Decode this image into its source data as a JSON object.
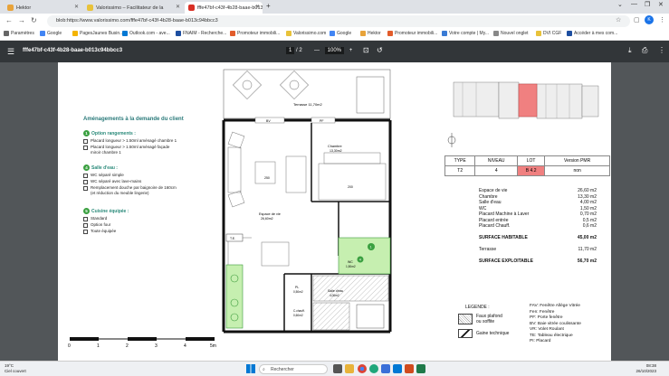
{
  "browser": {
    "tabs": [
      {
        "label": "Hektor",
        "color": "#e8a33a"
      },
      {
        "label": "Valorissimo – Facilitateur de la",
        "color": "#e8c23a"
      },
      {
        "label": "fffe47bf-c43f-4b28-baae-b013",
        "color": "#d93025"
      }
    ],
    "new_tab": "+",
    "url": "blob:https://www.valorissimo.com/fffe47bf-c43f-4b28-baae-b013c94bbcc3",
    "bookmarks": [
      "Paramètres",
      "Google",
      "PagesJaunes Busin...",
      "Outlook.com - ave...",
      "FNAIM - Recherche...",
      "Promoteur immobili...",
      "Valorissimo.com",
      "Google",
      "Hektor",
      "Promoteur immobili...",
      "Votre compte | My...",
      "Nouvel onglet",
      "DVI CGF",
      "Accéder à mes com..."
    ]
  },
  "pdf": {
    "title": "fffe47bf-c43f-4b28-baae-b013c94bbcc3",
    "page_current": "1",
    "page_total": "/ 2",
    "zoom": "100%"
  },
  "doc": {
    "heading": "Aménagements à la demande du client",
    "options": [
      {
        "num": "1",
        "title": "Option rangements :",
        "items": [
          "Placard longueur > 1.50ml aménagé chambre 1",
          "Placard longueur > 1.50ml aménagé façade",
          "miroir chambre 1"
        ]
      },
      {
        "num": "4",
        "title": "Salle d'eau :",
        "items": [
          "WC séparé simple",
          "WC séparé avec lave-mains",
          "Remplacement douche par baignoire de 160cm",
          "(et réduction du meuble lingerie)"
        ]
      },
      {
        "num": "5",
        "title": "Cuisine équipée :",
        "items": [
          "Standard",
          "Option four",
          "Toute équipée"
        ]
      }
    ],
    "plan_labels": {
      "terrasse": "Terrasse 11,70m2",
      "bv": "BV",
      "pf": "PF",
      "chambre": "Chambre",
      "chambre_area": "13,30m2",
      "sejour": "Espace de vie",
      "sejour_area": "26,60m2",
      "te": "T.E.",
      "wc": "WC",
      "wc_area": "1,50m2",
      "pl": "PL",
      "pl_area": "0,50m2",
      "salle_eau": "Salle d'eau",
      "salle_eau_area": "4,00m2",
      "chauf": "C.chauff.",
      "chauf_area": "0,60m2",
      "d250": "250",
      "d200": "200",
      "g1": "1",
      "g4": "4"
    },
    "scale": [
      "0",
      "1",
      "2",
      "3",
      "4",
      "5m"
    ],
    "table": {
      "headers": [
        "TYPE",
        "NIVEAU",
        "LOT",
        "Version PMR"
      ],
      "values": [
        "T2",
        "4",
        "B 4.2",
        "non"
      ],
      "lot_color": "#f08080"
    },
    "surfaces": [
      {
        "label": "Espace de vie",
        "value": "26,60 m2",
        "bold": false
      },
      {
        "label": "Chambre",
        "value": "13,30 m2",
        "bold": false
      },
      {
        "label": "Salle d'eau",
        "value": "4,00 m2",
        "bold": false
      },
      {
        "label": "WC",
        "value": "1,50 m2",
        "bold": false
      },
      {
        "label": "Placard Machine à Laver",
        "value": "0,70 m2",
        "bold": false
      },
      {
        "label": "Placard entrée",
        "value": "0,5 m2",
        "bold": false
      },
      {
        "label": "Placard Chauff.",
        "value": "0,6 m2",
        "bold": false
      },
      {
        "label": "",
        "value": "",
        "bold": false
      },
      {
        "label": "SURFACE HABITABLE",
        "value": "45,00 m2",
        "bold": true
      },
      {
        "label": "",
        "value": "",
        "bold": false
      },
      {
        "label": "Terrasse",
        "value": "11,70 m2",
        "bold": false
      },
      {
        "label": "",
        "value": "",
        "bold": false
      },
      {
        "label": "SURFACE EXPLOITABLE",
        "value": "56,70 m2",
        "bold": true
      }
    ],
    "legend": {
      "title": "LEGENDE :",
      "faux_plafond": "Faux plafond",
      "soffite": "ou soffite",
      "gaine": "Gaine technique"
    },
    "abbreviations": [
      "FAV: Fenêtre Allège Vitrée",
      "Fen: Fenêtre",
      "PF: Porte fenêtre",
      "BV: Baie vitrée coulissante",
      "VR: Volet Roulant",
      "TE: Tableau électrique",
      "PI: Placard"
    ]
  },
  "taskbar": {
    "temp": "19°C",
    "weather": "Ciel couvert",
    "search": "Rechercher",
    "time": "08:38",
    "date": "26/10/2023"
  }
}
